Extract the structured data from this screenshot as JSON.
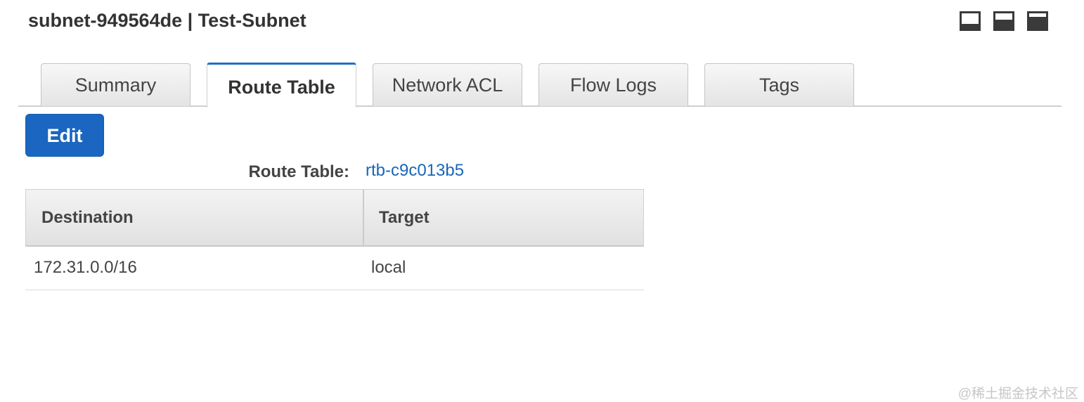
{
  "header": {
    "title": "subnet-949564de | Test-Subnet",
    "panel_icons": [
      "panel-bottom-small-icon",
      "panel-bottom-half-icon",
      "panel-bottom-large-icon"
    ]
  },
  "tabs": [
    {
      "label": "Summary",
      "active": false
    },
    {
      "label": "Route Table",
      "active": true
    },
    {
      "label": "Network ACL",
      "active": false
    },
    {
      "label": "Flow Logs",
      "active": false
    },
    {
      "label": "Tags",
      "active": false
    }
  ],
  "toolbar": {
    "edit_label": "Edit"
  },
  "route_table": {
    "label": "Route Table:",
    "id": "rtb-c9c013b5",
    "columns": [
      "Destination",
      "Target"
    ],
    "rows": [
      {
        "destination": "172.31.0.0/16",
        "target": "local"
      }
    ]
  },
  "watermark": "@稀土掘金技术社区",
  "colors": {
    "accent": "#1a66c0",
    "link": "#1a66b8",
    "active_tab_border": "#1f6fc5"
  }
}
